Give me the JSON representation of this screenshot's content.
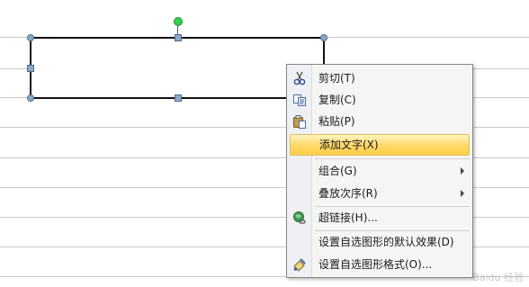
{
  "context_menu": {
    "items": [
      {
        "label": "剪切(T)",
        "icon": "scissors-icon"
      },
      {
        "label": "复制(C)",
        "icon": "copy-icon"
      },
      {
        "label": "粘贴(P)",
        "icon": "paste-icon"
      },
      {
        "label": "添加文字(X)",
        "highlighted": true
      },
      {
        "label": "组合(G)",
        "submenu": true
      },
      {
        "label": "叠放次序(R)",
        "submenu": true
      },
      {
        "label": "超链接(H)...",
        "icon": "hyperlink-globe-icon"
      },
      {
        "label": "设置自选图形的默认效果(D)"
      },
      {
        "label": "设置自选图形格式(O)...",
        "icon": "format-shape-icon"
      }
    ]
  },
  "watermark": {
    "text": "Baidu 经验"
  },
  "colors": {
    "highlight_border": "#e3be5b",
    "highlight_fill": "#ffd96a",
    "rotate_handle": "#2fd04a"
  }
}
